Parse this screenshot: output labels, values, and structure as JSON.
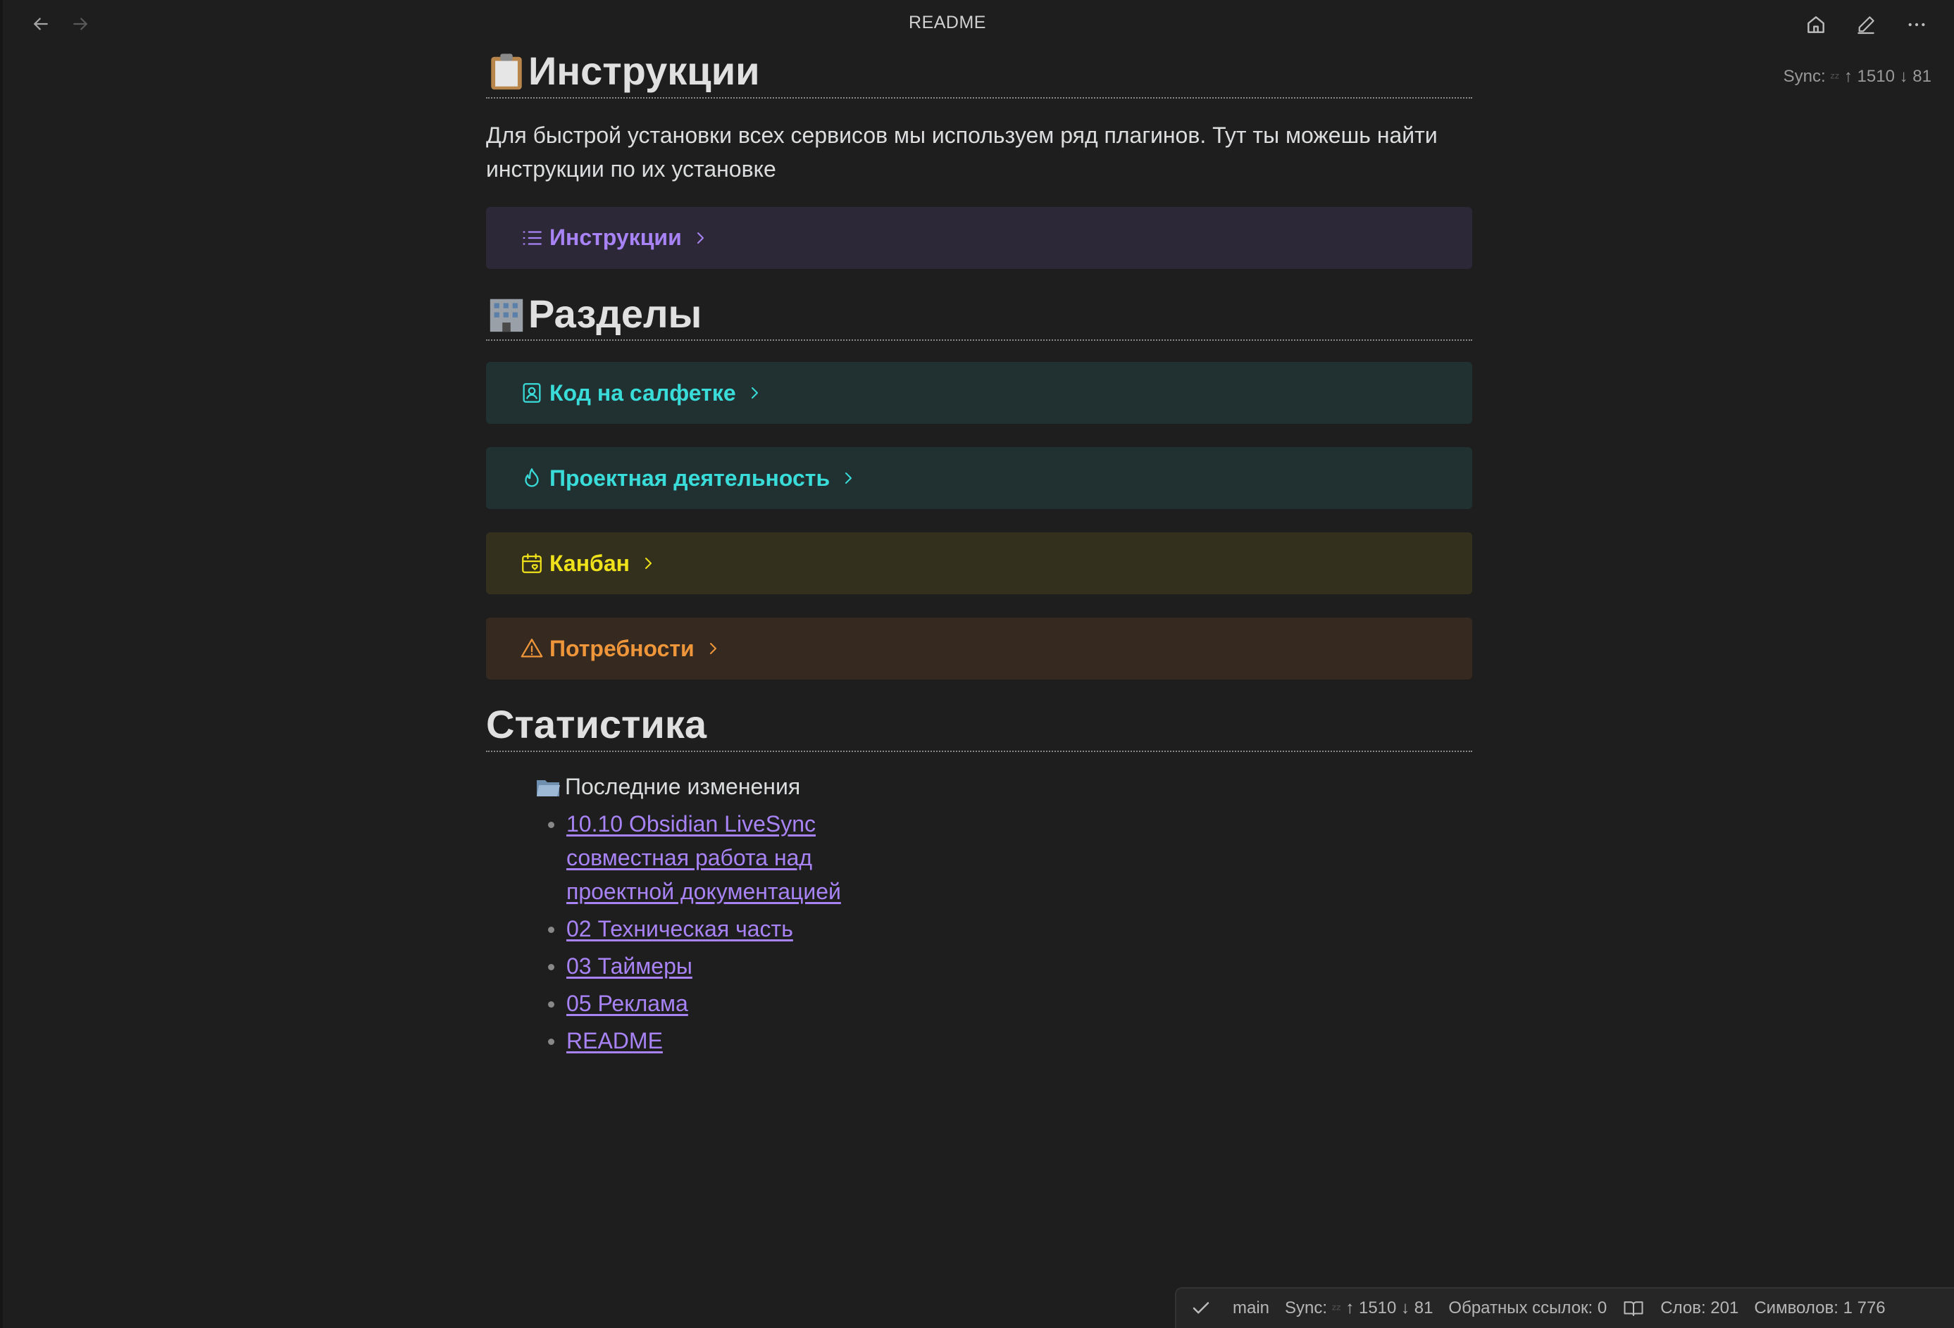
{
  "window": {
    "title": "README"
  },
  "toolbar": {
    "back_icon": "arrow-left-icon",
    "forward_icon": "arrow-right-icon",
    "home_icon": "home-icon",
    "edit_icon": "pencil-icon",
    "more_icon": "more-horizontal-icon"
  },
  "sync_top": {
    "label": "Sync:",
    "up": "↑ 1510",
    "down": "↓ 81"
  },
  "sections": {
    "instructions": {
      "heading": "Инструкции",
      "emoji": "clipboard-emoji",
      "text": "Для быстрой установки всех сервисов мы используем ряд плагинов. Тут ты можешь найти инструкции по их установке",
      "callout": {
        "label": "Инструкции",
        "icon": "list-icon",
        "color": "#a883f5"
      }
    },
    "razdely": {
      "heading": "Разделы",
      "emoji": "building-emoji",
      "callouts": [
        {
          "label": "Код на салфетке",
          "icon": "contact-book-icon",
          "color": "#39dcd8"
        },
        {
          "label": "Проектная деятельность",
          "icon": "flame-icon",
          "color": "#39dcd8"
        },
        {
          "label": "Канбан",
          "icon": "calendar-heart-icon",
          "color": "#f0e21a"
        },
        {
          "label": "Потребности",
          "icon": "warning-triangle-icon",
          "color": "#f0963a"
        }
      ]
    },
    "stats": {
      "heading": "Статистика",
      "root": "Последние изменения",
      "items": [
        "10.10 Obsidian LiveSync совместная работа над проектной документацией",
        "02 Техническая часть",
        "03 Таймеры",
        "05 Реклама",
        "README"
      ]
    }
  },
  "statusbar": {
    "branch": "main",
    "sync_label": "Sync:",
    "sync_up": "↑ 1510",
    "sync_down": "↓ 81",
    "backlinks": "Обратных ссылок: 0",
    "words": "Слов: 201",
    "chars": "Символов: 1 776"
  }
}
